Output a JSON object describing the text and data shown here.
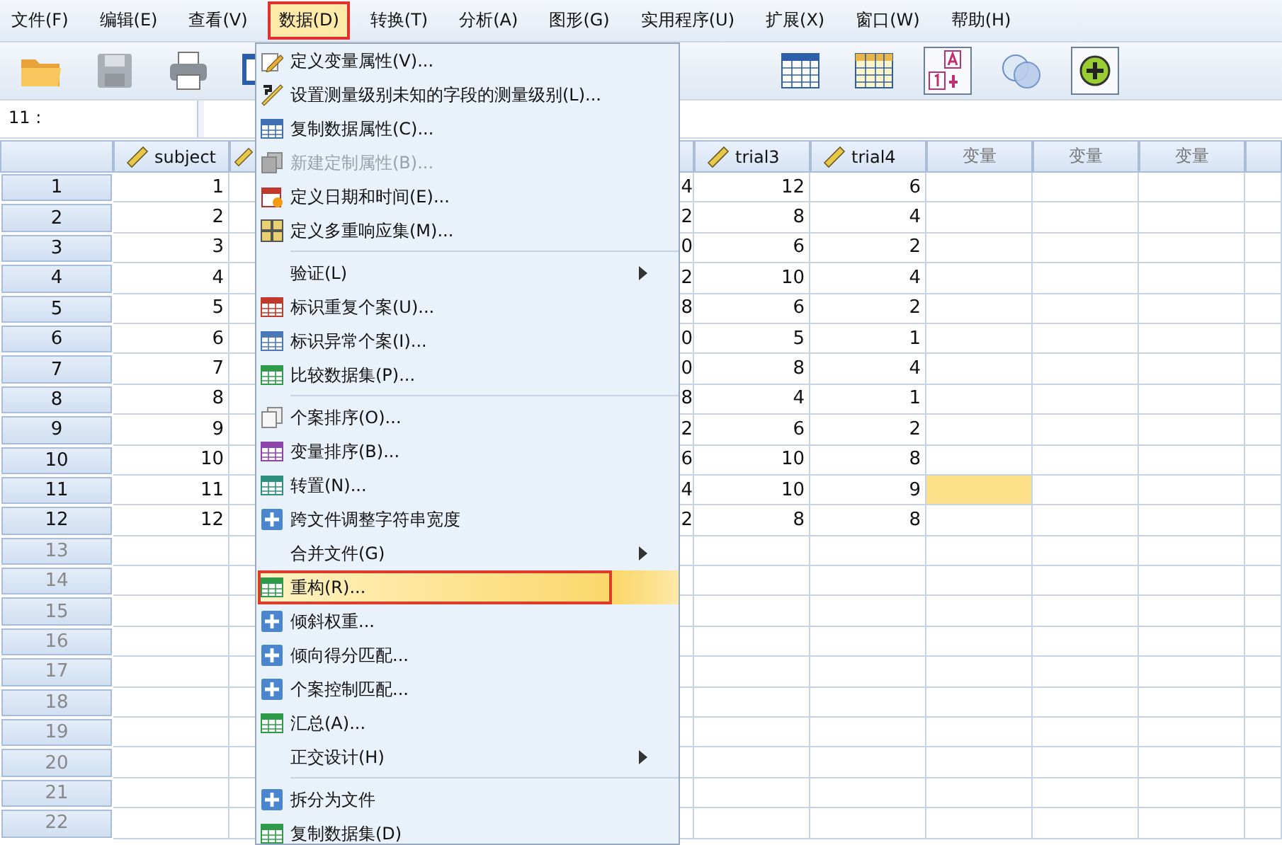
{
  "menubar": [
    {
      "label": "文件(F)",
      "selected": false
    },
    {
      "label": "编辑(E)",
      "selected": false
    },
    {
      "label": "查看(V)",
      "selected": false
    },
    {
      "label": "数据(D)",
      "selected": true
    },
    {
      "label": "转换(T)",
      "selected": false
    },
    {
      "label": "分析(A)",
      "selected": false
    },
    {
      "label": "图形(G)",
      "selected": false
    },
    {
      "label": "实用程序(U)",
      "selected": false
    },
    {
      "label": "扩展(X)",
      "selected": false
    },
    {
      "label": "窗口(W)",
      "selected": false
    },
    {
      "label": "帮助(H)",
      "selected": false
    }
  ],
  "toolbar": [
    {
      "kind": "folder",
      "disabled": false
    },
    {
      "kind": "save",
      "disabled": true
    },
    {
      "kind": "printer",
      "disabled": false
    },
    {
      "kind": "dialog",
      "disabled": false
    },
    {
      "kind": "table",
      "disabled": false
    },
    {
      "kind": "table-yellow",
      "disabled": false
    },
    {
      "kind": "value-labels",
      "disabled": false
    },
    {
      "kind": "circles",
      "disabled": false
    },
    {
      "kind": "plus-circle",
      "disabled": false
    }
  ],
  "cell_editor": {
    "reference": "11 :"
  },
  "columns": [
    {
      "label": "subject",
      "kind": "scale"
    },
    {
      "kind": "scale"
    },
    {
      "label": "trial3",
      "kind": "scale"
    },
    {
      "label": "trial4",
      "kind": "scale"
    },
    {
      "label": "变量",
      "kind": "empty"
    },
    {
      "label": "变量",
      "kind": "empty"
    },
    {
      "label": "变量",
      "kind": "empty"
    }
  ],
  "rows": [
    {
      "number": "1",
      "cells": [
        "1",
        "4",
        "12",
        "6"
      ],
      "active_cell": false
    },
    {
      "number": "2",
      "cells": [
        "2",
        "2",
        "8",
        "4"
      ],
      "active_cell": false
    },
    {
      "number": "3",
      "cells": [
        "3",
        "0",
        "6",
        "2"
      ],
      "active_cell": false
    },
    {
      "number": "4",
      "cells": [
        "4",
        "2",
        "10",
        "4"
      ],
      "active_cell": false
    },
    {
      "number": "5",
      "cells": [
        "5",
        "8",
        "6",
        "2"
      ],
      "active_cell": false
    },
    {
      "number": "6",
      "cells": [
        "6",
        "0",
        "5",
        "1"
      ],
      "active_cell": false
    },
    {
      "number": "7",
      "cells": [
        "7",
        "0",
        "8",
        "4"
      ],
      "active_cell": false
    },
    {
      "number": "8",
      "cells": [
        "8",
        "8",
        "4",
        "1"
      ],
      "active_cell": false
    },
    {
      "number": "9",
      "cells": [
        "9",
        "2",
        "6",
        "2"
      ],
      "active_cell": false
    },
    {
      "number": "10",
      "cells": [
        "10",
        "6",
        "10",
        "8"
      ],
      "active_cell": false
    },
    {
      "number": "11",
      "cells": [
        "11",
        "4",
        "10",
        "9"
      ],
      "active_cell": true
    },
    {
      "number": "12",
      "cells": [
        "12",
        "2",
        "8",
        "8"
      ],
      "active_cell": false
    },
    {
      "number": "13",
      "active_cell": false
    },
    {
      "number": "14",
      "active_cell": false
    },
    {
      "number": "15",
      "active_cell": false
    },
    {
      "number": "16",
      "active_cell": false
    },
    {
      "number": "17",
      "active_cell": false
    },
    {
      "number": "18",
      "active_cell": false
    },
    {
      "number": "19",
      "active_cell": false
    },
    {
      "number": "20",
      "active_cell": false
    },
    {
      "number": "21",
      "active_cell": false
    },
    {
      "number": "22",
      "active_cell": false
    }
  ],
  "data_menu": [
    {
      "kind": "item",
      "label": "定义变量属性(V)...",
      "disabled": false,
      "selected": false
    },
    {
      "kind": "item",
      "label": "设置测量级别未知的字段的测量级别(L)...",
      "disabled": false,
      "selected": false
    },
    {
      "kind": "item",
      "label": "复制数据属性(C)...",
      "disabled": false,
      "selected": false
    },
    {
      "kind": "item",
      "label": "新建定制属性(B)...",
      "disabled": true,
      "selected": false
    },
    {
      "kind": "item",
      "label": "定义日期和时间(E)...",
      "disabled": false,
      "selected": false
    },
    {
      "kind": "item",
      "label": "定义多重响应集(M)...",
      "disabled": false,
      "selected": false
    },
    {
      "kind": "separator"
    },
    {
      "kind": "submenu",
      "label": "验证(L)",
      "disabled": false,
      "selected": false
    },
    {
      "kind": "item",
      "label": "标识重复个案(U)...",
      "disabled": false,
      "selected": false
    },
    {
      "kind": "item",
      "label": "标识异常个案(I)...",
      "disabled": false,
      "selected": false
    },
    {
      "kind": "item",
      "label": "比较数据集(P)...",
      "disabled": false,
      "selected": false
    },
    {
      "kind": "separator"
    },
    {
      "kind": "item",
      "label": "个案排序(O)...",
      "disabled": false,
      "selected": false
    },
    {
      "kind": "item",
      "label": "变量排序(B)...",
      "disabled": false,
      "selected": false
    },
    {
      "kind": "item",
      "label": "转置(N)...",
      "disabled": false,
      "selected": false
    },
    {
      "kind": "item",
      "label": "跨文件调整字符串宽度",
      "disabled": false,
      "selected": false
    },
    {
      "kind": "submenu",
      "label": "合并文件(G)",
      "disabled": false,
      "selected": false
    },
    {
      "kind": "item",
      "label": "重构(R)...",
      "disabled": false,
      "selected": true
    },
    {
      "kind": "item",
      "label": "倾斜权重...",
      "disabled": false,
      "selected": false
    },
    {
      "kind": "item",
      "label": "倾向得分匹配...",
      "disabled": false,
      "selected": false
    },
    {
      "kind": "item",
      "label": "个案控制匹配...",
      "disabled": false,
      "selected": false
    },
    {
      "kind": "item",
      "label": "汇总(A)...",
      "disabled": false,
      "selected": false
    },
    {
      "kind": "submenu",
      "label": "正交设计(H)",
      "disabled": false,
      "selected": false
    },
    {
      "kind": "separator"
    },
    {
      "kind": "item",
      "label": "拆分为文件",
      "disabled": false,
      "selected": false
    },
    {
      "kind": "item",
      "label": "复制数据集(D)",
      "disabled": false,
      "selected": false
    }
  ]
}
